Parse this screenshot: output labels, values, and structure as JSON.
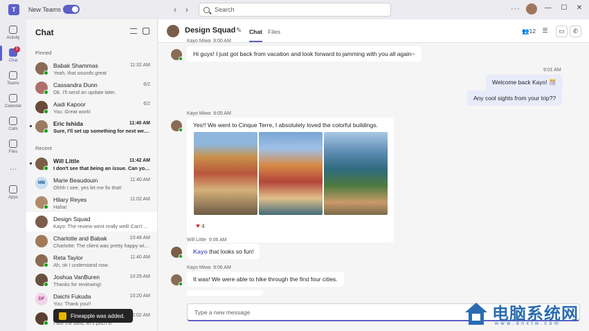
{
  "titlebar": {
    "logo": "T",
    "new_teams_label": "New Teams",
    "new_teams_enabled": true,
    "search_placeholder": "Search",
    "more": "···",
    "minimize": "—",
    "maximize": "☐",
    "close": "✕"
  },
  "rail": {
    "items": [
      {
        "label": "Activity",
        "icon": "bell-icon"
      },
      {
        "label": "Chat",
        "icon": "chat-icon",
        "badge": "1",
        "active": true
      },
      {
        "label": "Teams",
        "icon": "teams-icon"
      },
      {
        "label": "Calendar",
        "icon": "calendar-icon"
      },
      {
        "label": "Calls",
        "icon": "phone-icon"
      },
      {
        "label": "Files",
        "icon": "file-icon"
      },
      {
        "label": "···",
        "icon": "more-icon"
      },
      {
        "label": "Apps",
        "icon": "apps-icon"
      }
    ]
  },
  "chatlist": {
    "title": "Chat",
    "pinned_label": "Pinned",
    "recent_label": "Recent",
    "pinned": [
      {
        "name": "Babak Shammas",
        "preview": "Yeah, that sounds great",
        "time": "11:32 AM"
      },
      {
        "name": "Cassandra Dunn",
        "preview": "Ok. I'll send an update later.",
        "time": "6/2"
      },
      {
        "name": "Aadi Kapoor",
        "preview": "You: Great work!",
        "time": "6/2"
      },
      {
        "name": "Eric Ishida",
        "preview": "Sure, I'll set up something for next week t...",
        "time": "11:40 AM",
        "unread": true
      }
    ],
    "recent": [
      {
        "name": "Will Little",
        "preview": "I don't see that being an issue. Can you ta...",
        "time": "11:42 AM",
        "unread": true
      },
      {
        "name": "Marie Beaudouin",
        "preview": "Ohhh I see, yes let me fix that!",
        "time": "11:40 AM",
        "initials": "MB"
      },
      {
        "name": "Hilary Reyes",
        "preview": "Haha!",
        "time": "11:02 AM"
      },
      {
        "name": "Design Squad",
        "preview": "Kayo: The review went really well! Can't wai...",
        "time": "",
        "selected": true
      },
      {
        "name": "Charlotte and Babak",
        "preview": "Charlotte: The client was pretty happy with...",
        "time": "10:48 AM"
      },
      {
        "name": "Reta Taylor",
        "preview": "Ah, ok I understand now.",
        "time": "11:40 AM"
      },
      {
        "name": "Joshua VanBuren",
        "preview": "Thanks for reviewing!",
        "time": "10:29 AM"
      },
      {
        "name": "Daichi Fukuda",
        "preview": "You: Thank you!!",
        "time": "10:20 AM",
        "initials": "DF"
      },
      {
        "name": "",
        "preview": "I like the idea, let's pitch it!",
        "time": "2:02 AM"
      }
    ]
  },
  "toast": {
    "text": "Fineapple was added."
  },
  "conversation": {
    "title": "Design Squad",
    "tabs": [
      "Chat",
      "Files"
    ],
    "participants": "12",
    "messages": [
      {
        "sender": "Kayo Miwa",
        "time": "9:00 AM",
        "text": "Hi guys! I just got back from vacation and look forward to jamming with you all again~"
      },
      {
        "sender": "",
        "time": "9:01 AM",
        "mine": true,
        "text": "Welcome back Kayo! 🎊"
      },
      {
        "sender": "",
        "time": "",
        "mine": true,
        "text": "Any cool sights from your trip??"
      },
      {
        "sender": "Kayo Miwa",
        "time": "9:05 AM",
        "text": "Yes!! We went to Cinque Terre, I absolutely loved the colorful buildings.",
        "reaction": "4"
      },
      {
        "sender": "Will Little",
        "time": "9:06 AM",
        "mention": "Kayo",
        "text": "that looks so fun!"
      },
      {
        "sender": "Kayo Miwa",
        "time": "9:06 AM",
        "text": "It was! We were able to hike through the first four cities."
      }
    ],
    "compose_placeholder": "Type a new message"
  },
  "watermark": {
    "title": "电脑系统网",
    "url": "www.dnxtw.com"
  }
}
